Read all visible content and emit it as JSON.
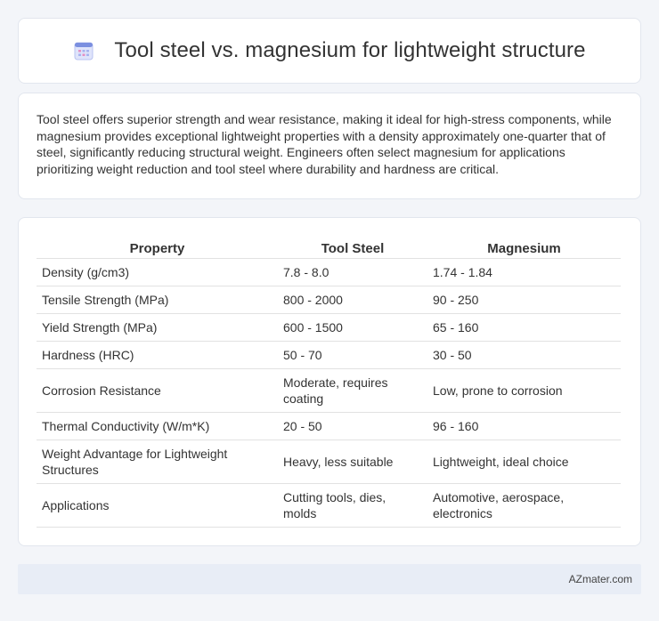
{
  "header": {
    "title": "Tool steel vs. magnesium for lightweight structure",
    "icon": "calendar-icon"
  },
  "intro": {
    "text": "Tool steel offers superior strength and wear resistance, making it ideal for high-stress components, while magnesium provides exceptional lightweight properties with a density approximately one-quarter that of steel, significantly reducing structural weight. Engineers often select magnesium for applications prioritizing weight reduction and tool steel where durability and hardness are critical."
  },
  "table": {
    "headers": [
      "Property",
      "Tool Steel",
      "Magnesium"
    ],
    "rows": [
      [
        "Density (g/cm3)",
        "7.8 - 8.0",
        "1.74 - 1.84"
      ],
      [
        "Tensile Strength (MPa)",
        "800 - 2000",
        "90 - 250"
      ],
      [
        "Yield Strength (MPa)",
        "600 - 1500",
        "65 - 160"
      ],
      [
        "Hardness (HRC)",
        "50 - 70",
        "30 - 50"
      ],
      [
        "Corrosion Resistance",
        "Moderate, requires coating",
        "Low, prone to corrosion"
      ],
      [
        "Thermal Conductivity (W/m*K)",
        "20 - 50",
        "96 - 160"
      ],
      [
        "Weight Advantage for Lightweight Structures",
        "Heavy, less suitable",
        "Lightweight, ideal choice"
      ],
      [
        "Applications",
        "Cutting tools, dies, molds",
        "Automotive, aerospace, electronics"
      ]
    ]
  },
  "footer": {
    "brand": "AZmater.com"
  },
  "colors": {
    "page_bg": "#f3f5f9",
    "card_bg": "#ffffff",
    "footer_bg": "#e8edf6",
    "icon_accent": "#7b8fe0"
  }
}
